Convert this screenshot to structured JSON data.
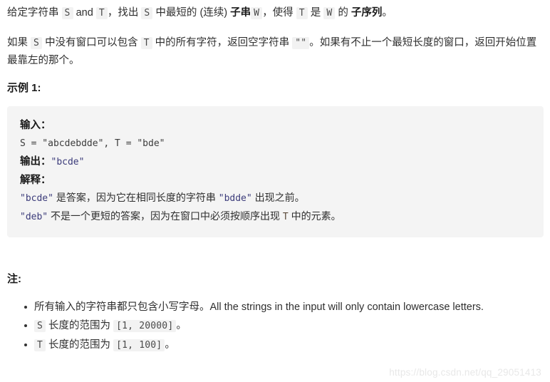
{
  "problem": {
    "paragraph1": {
      "seg1": "给定字符串 ",
      "code_s": "S",
      "seg2": " and ",
      "code_t": "T",
      "seg3": "，找出 ",
      "code_s2": "S",
      "seg4": " 中最短的 (连续) ",
      "bold1": "子串",
      "code_w": "W",
      "seg5": "，使得 ",
      "code_t2": "T",
      "seg6": " 是 ",
      "code_w2": "W",
      "seg7": " 的 ",
      "bold2": "子序列",
      "seg8": "。"
    },
    "paragraph2": {
      "seg1": "如果 ",
      "code_s": "S",
      "seg2": " 中没有窗口可以包含 ",
      "code_t": "T",
      "seg3": " 中的所有字符，返回空字符串 ",
      "code_empty": "\"\"",
      "seg4": "。如果有不止一个最短长度的窗口，返回开始位置最靠左的那个。"
    }
  },
  "example": {
    "heading": "示例 1:",
    "input_label": "输入：",
    "input_value": "S = \"abcdebdde\", T = \"bde\"",
    "output_label": "输出：",
    "output_value": "\"bcde\"",
    "explain_label": "解释：",
    "explain_line1_a": "\"bcde\"",
    "explain_line1_b": " 是答案，因为它在相同长度的字符串 ",
    "explain_line1_c": "\"bdde\"",
    "explain_line1_d": " 出现之前。",
    "explain_line2_a": "\"deb\"",
    "explain_line2_b": " 不是一个更短的答案，因为在窗口中必须按顺序出现 ",
    "explain_line2_c": "T",
    "explain_line2_d": " 中的元素。"
  },
  "notes": {
    "heading": "注:",
    "items": [
      {
        "text_cn": "所有输入的字符串都只包含小写字母。",
        "text_en": "All the strings in the input will only contain lowercase letters.",
        "code_prefix": "",
        "range": "",
        "suffix": ""
      },
      {
        "code_prefix": "S",
        "text_cn": " 长度的范围为 ",
        "range": "[1, 20000]",
        "suffix": "。",
        "text_en": ""
      },
      {
        "code_prefix": "T",
        "text_cn": " 长度的范围为 ",
        "range": "[1, 100]",
        "suffix": "。",
        "text_en": ""
      }
    ]
  },
  "watermark": "https://blog.csdn.net/qq_29051413"
}
